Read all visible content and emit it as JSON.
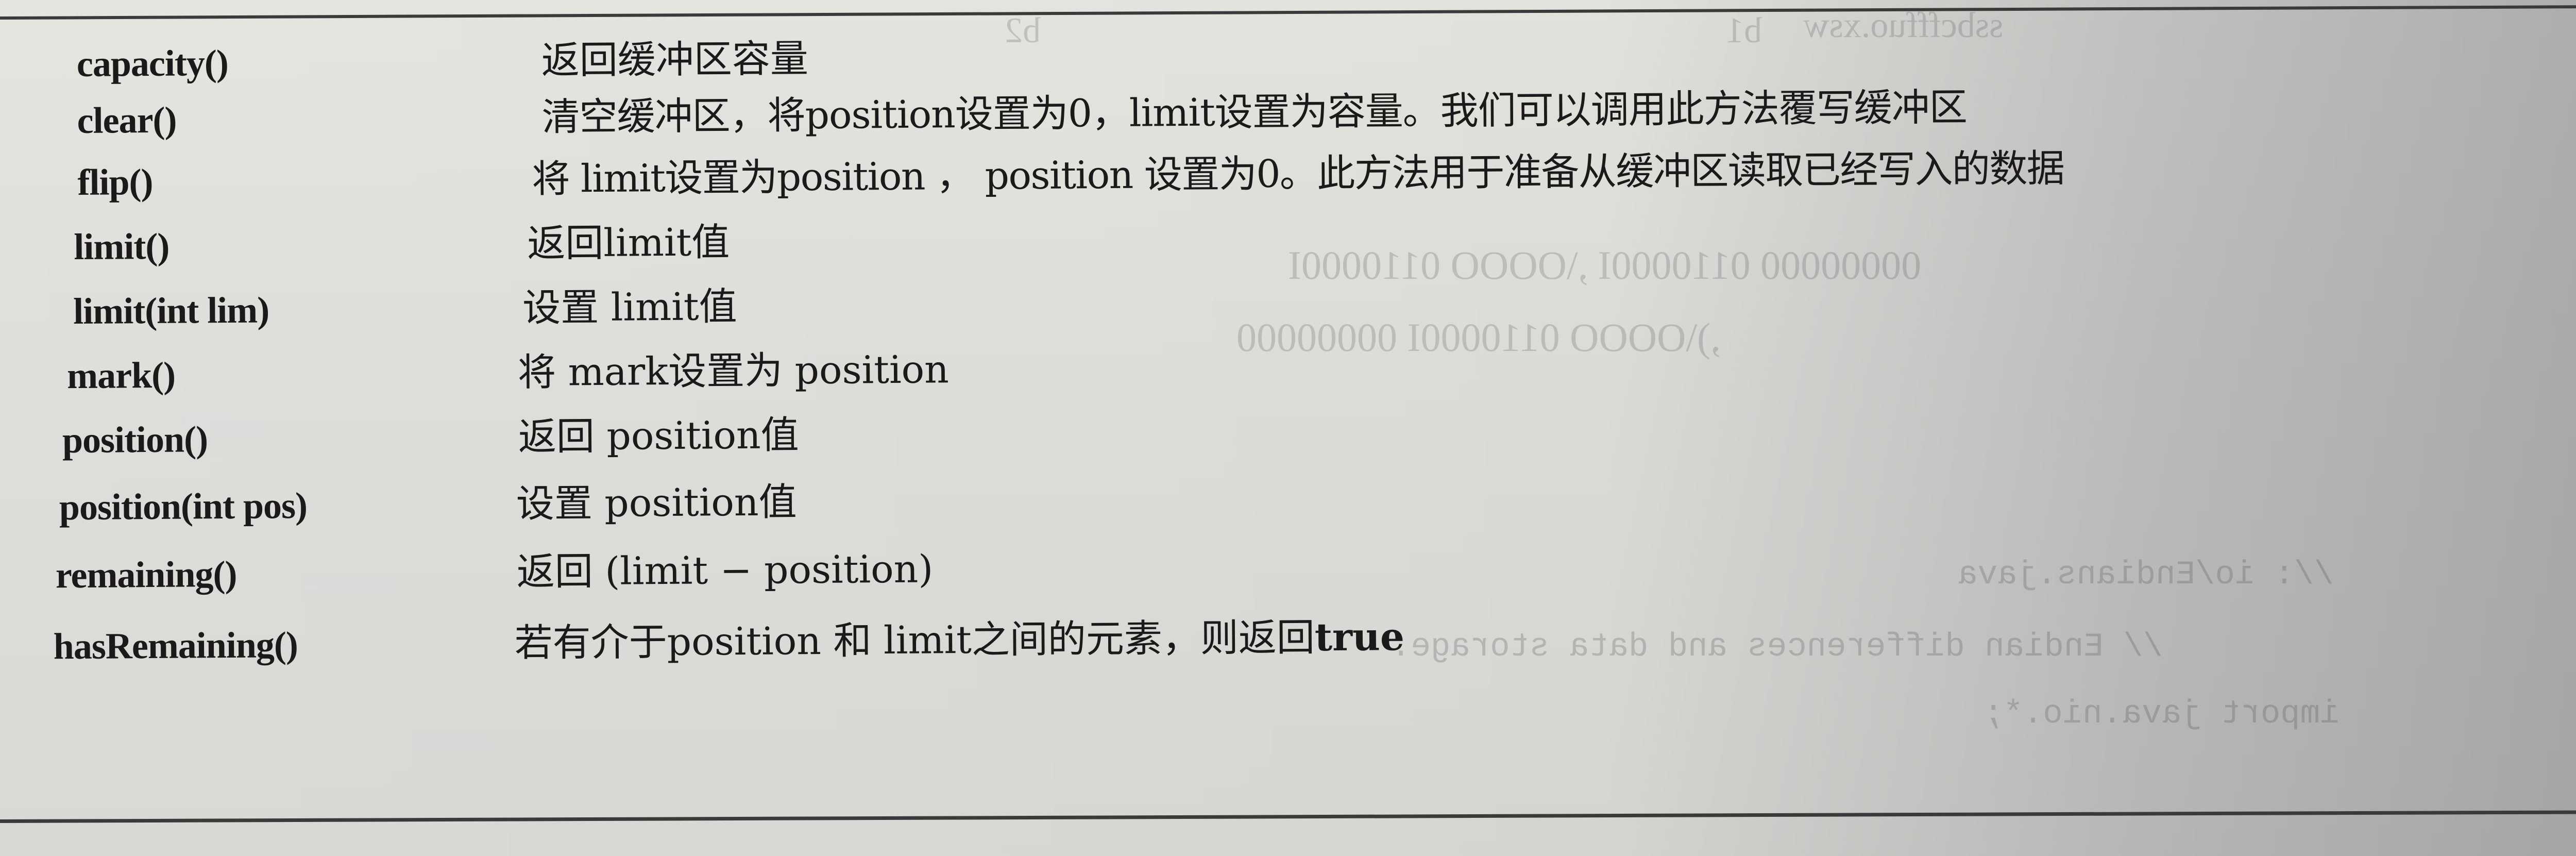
{
  "methods": [
    {
      "name": "capacity()",
      "desc": "返回缓冲区容量"
    },
    {
      "name": "clear()",
      "desc": "清空缓冲区，将position设置为0，limit设置为容量。我们可以调用此方法覆写缓冲区"
    },
    {
      "name": "flip()",
      "desc": "将 limit设置为position ， position 设置为0。此方法用于准备从缓冲区读取已经写入的数据"
    },
    {
      "name": "limit()",
      "desc": "返回limit值"
    },
    {
      "name": "limit(int lim)",
      "desc": "设置 limit值"
    },
    {
      "name": "mark()",
      "desc": "将 mark设置为 position"
    },
    {
      "name": "position()",
      "desc": "返回 position值"
    },
    {
      "name": "position(int pos)",
      "desc": "设置 position值"
    },
    {
      "name": "remaining()",
      "desc": "返回 (limit − position)"
    },
    {
      "name": "hasRemaining()",
      "desc_prefix": "若有介于position 和 limit之间的元素，则返回",
      "desc_bold": "true"
    }
  ]
}
